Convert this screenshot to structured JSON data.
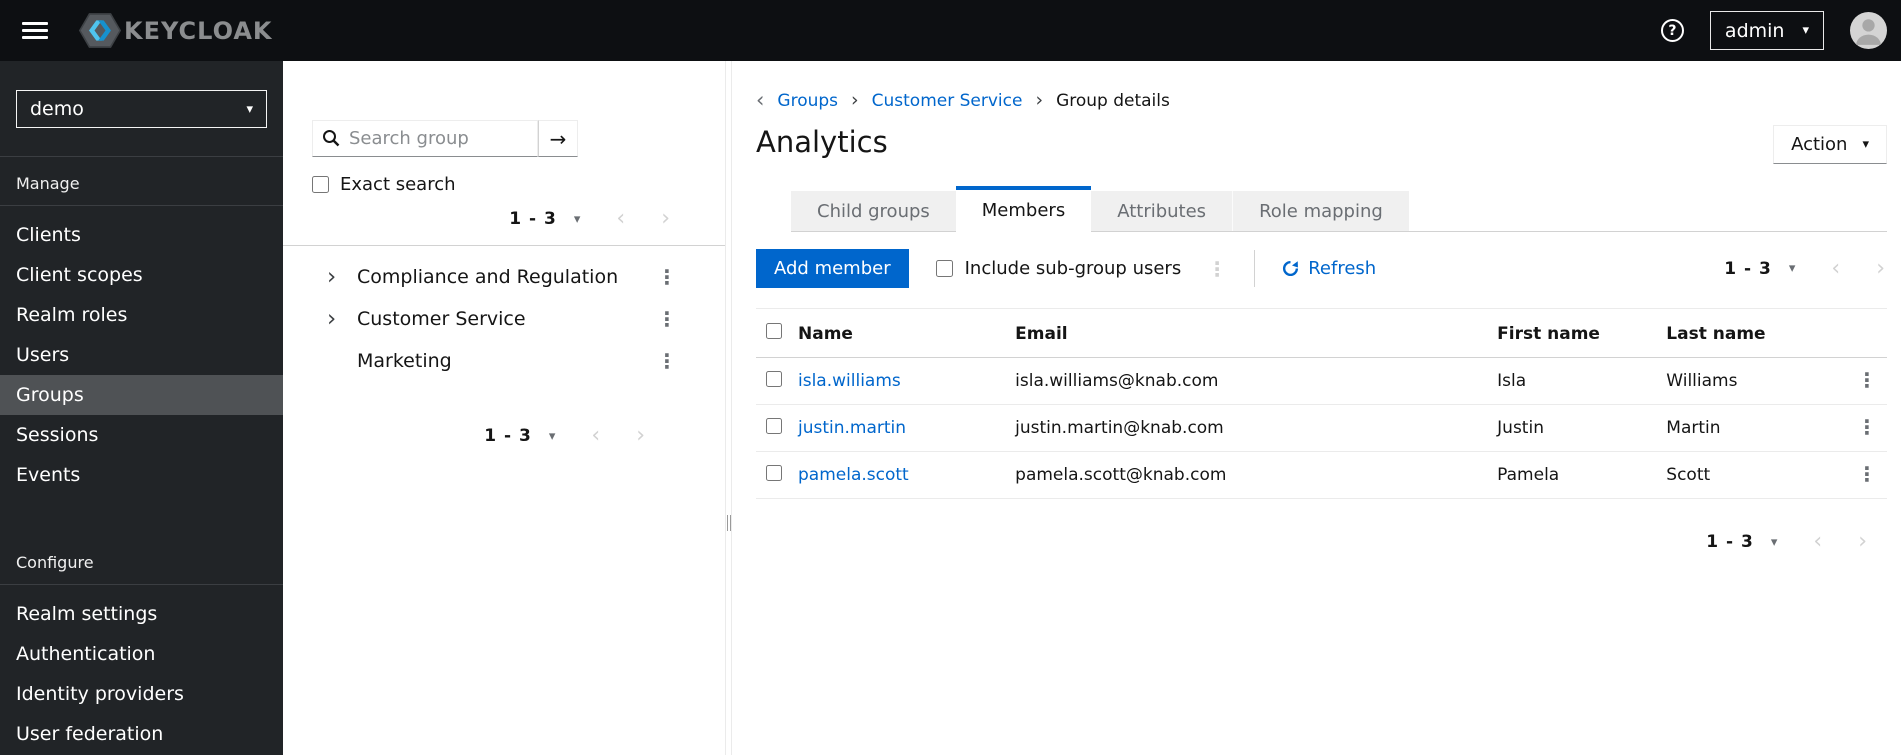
{
  "colors": {
    "primary": "#0066cc",
    "link": "#0066cc",
    "masthead_bg": "#0d0f12",
    "sidebar_bg": "#212427",
    "sidebar_selected_bg": "#4f5255",
    "tab_inactive_bg": "#f0f0f0",
    "border": "#d2d2d2",
    "logo_blue_light": "#4fc4ef",
    "logo_blue_dark": "#1691ce"
  },
  "icons": {
    "hamburger": "menu-bars",
    "keycloak_logo": "hexagon-chevrons",
    "help": "?",
    "avatar": "person-silhouette",
    "search": "magnifier",
    "refresh": "circular-arrow",
    "kebab": "⋮",
    "caret_down": "▾",
    "chevron_left": "‹",
    "chevron_right": "›",
    "arrow_right": "→"
  },
  "masthead": {
    "brand": "KEYCLOAK",
    "help_glyph": "?",
    "username": "admin"
  },
  "sidebar": {
    "realm_selector": {
      "value": "demo"
    },
    "sections": [
      {
        "title": "Manage",
        "items": [
          {
            "label": "Clients"
          },
          {
            "label": "Client scopes"
          },
          {
            "label": "Realm roles"
          },
          {
            "label": "Users"
          },
          {
            "label": "Groups",
            "selected": true
          },
          {
            "label": "Sessions"
          },
          {
            "label": "Events"
          }
        ]
      },
      {
        "title": "Configure",
        "items": [
          {
            "label": "Realm settings"
          },
          {
            "label": "Authentication"
          },
          {
            "label": "Identity providers"
          },
          {
            "label": "User federation"
          }
        ]
      }
    ]
  },
  "groups_panel": {
    "search": {
      "placeholder": "Search group",
      "value": ""
    },
    "exact_search_label": "Exact search",
    "top_pagination": {
      "range": "1 - 3"
    },
    "tree": [
      {
        "label": "Compliance and Regulation",
        "expandable": true
      },
      {
        "label": "Customer Service",
        "expandable": true
      },
      {
        "label": "Marketing",
        "expandable": false
      }
    ],
    "bottom_pagination": {
      "range": "1 - 3"
    }
  },
  "main": {
    "breadcrumb": {
      "items": [
        {
          "label": "Groups",
          "link": true
        },
        {
          "label": "Customer Service",
          "link": true
        },
        {
          "label": "Group details",
          "link": false
        }
      ]
    },
    "title": "Analytics",
    "action_button": {
      "label": "Action"
    },
    "tabs": [
      {
        "label": "Child groups"
      },
      {
        "label": "Members",
        "active": true
      },
      {
        "label": "Attributes"
      },
      {
        "label": "Role mapping"
      }
    ],
    "toolbar": {
      "add_member_label": "Add member",
      "include_subgroups_label": "Include sub-group users",
      "refresh_label": "Refresh",
      "pagination": {
        "range": "1 - 3"
      }
    },
    "table": {
      "columns": [
        "Name",
        "Email",
        "First name",
        "Last name"
      ],
      "rows": [
        {
          "name": "isla.williams",
          "email": "isla.williams@knab.com",
          "first_name": "Isla",
          "last_name": "Williams"
        },
        {
          "name": "justin.martin",
          "email": "justin.martin@knab.com",
          "first_name": "Justin",
          "last_name": "Martin"
        },
        {
          "name": "pamela.scott",
          "email": "pamela.scott@knab.com",
          "first_name": "Pamela",
          "last_name": "Scott"
        }
      ]
    },
    "bottom_pagination": {
      "range": "1 - 3"
    }
  }
}
